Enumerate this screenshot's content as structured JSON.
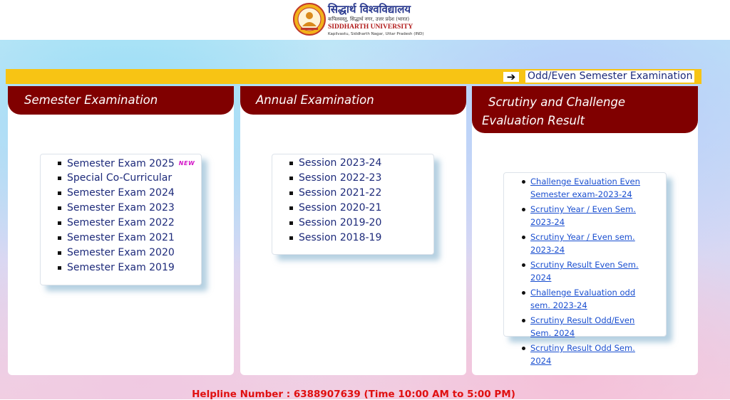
{
  "header": {
    "logo_hindi": "सिद्धार्थ विश्वविद्यालय",
    "logo_hindi_sub": "कपिलवस्तु, सिद्धार्थ नगर, उत्तर प्रदेश (भारत)",
    "logo_english": "SIDDHARTH UNIVERSITY",
    "logo_english_sub": "Kapilvastu, Siddharth Nagar, Uttar Pradesh (IND)"
  },
  "announcement": {
    "arrow_icon": "right-arrow-icon",
    "text": "Odd/Even Semester Examination"
  },
  "cards": {
    "semester": {
      "title": "Semester Examination",
      "items": [
        "Semester Exam 2025",
        "Special Co-Curricular",
        "Semester Exam 2024",
        "Semester Exam 2023",
        "Semester Exam 2022",
        "Semester Exam 2021",
        "Semester Exam 2020",
        "Semester Exam 2019"
      ],
      "new_badge": "NEW"
    },
    "annual": {
      "title": "Annual Examination",
      "items": [
        "Session 2023-24",
        "Session 2022-23",
        "Session 2021-22",
        "Session 2020-21",
        "Session 2019-20",
        "Session 2018-19"
      ]
    },
    "scrutiny": {
      "title": "Scrutiny and Challenge Evaluation Result",
      "items": [
        "Challenge Evaluation Even Semester exam-2023-24",
        "Scrutiny Year / Even Sem. 2023-24",
        "Scrutiny Year / Even sem. 2023-24",
        "Scrutiny Result Even Sem. 2024",
        "Challenge Evaluation odd sem. 2023-24",
        "Scrutiny Result Odd/Even Sem. 2024",
        "Scrutiny Result Odd Sem. 2024"
      ]
    }
  },
  "footer": {
    "helpline": "Helpline Number : 6388907639 (Time 10:00 AM to 5:00 PM)"
  },
  "colors": {
    "header_red": "#800000",
    "marquee_yellow": "#f7c414",
    "link_blue": "#1a4fd0",
    "text_navy": "#1d2a7a",
    "helpline_red": "#e01010"
  }
}
